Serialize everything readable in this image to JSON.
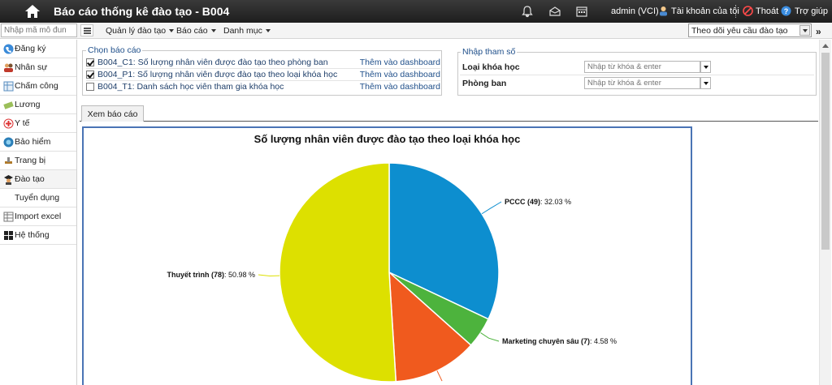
{
  "topbar": {
    "title": "Báo cáo thống kê đào tạo - B004",
    "user": "admin (VCI)",
    "account": "Tài khoản của tôi",
    "logout": "Thoát",
    "help": "Trợ giúp"
  },
  "navbar": {
    "module_placeholder": "Nhập mã mô đun",
    "menus": [
      "Quản lý đào tạo",
      "Báo cáo",
      "Danh mục"
    ],
    "track_selected": "Theo dõi yêu cầu đào tạo"
  },
  "sidebar": {
    "items": [
      {
        "label": "Đăng ký",
        "icon": "phone-icon"
      },
      {
        "label": "Nhân sự",
        "icon": "people-icon"
      },
      {
        "label": "Chấm công",
        "icon": "timesheet-icon"
      },
      {
        "label": "Lương",
        "icon": "money-icon"
      },
      {
        "label": "Y tế",
        "icon": "medical-icon"
      },
      {
        "label": "Bảo hiểm",
        "icon": "insurance-icon"
      },
      {
        "label": "Trang bị",
        "icon": "equipment-icon"
      },
      {
        "label": "Đào tạo",
        "icon": "graduate-icon"
      },
      {
        "label": "Tuyển dụng",
        "icon": ""
      },
      {
        "label": "Import excel",
        "icon": "excel-icon"
      },
      {
        "label": "Hệ thống",
        "icon": "windows-icon"
      }
    ]
  },
  "reports": {
    "legend": "Chọn báo cáo",
    "add_label": "Thêm vào dashboard",
    "items": [
      {
        "label": "B004_C1: Số lượng nhân viên được đào tạo theo phòng ban",
        "checked": true
      },
      {
        "label": "B004_P1: Số lượng nhân viên được đào tạo theo loại khóa học",
        "checked": true
      },
      {
        "label": "B004_T1: Danh sách học viên tham gia khóa học",
        "checked": false
      }
    ]
  },
  "params": {
    "legend": "Nhập tham số",
    "fields": [
      {
        "label": "Loại khóa học",
        "placeholder": "Nhập từ khóa & enter"
      },
      {
        "label": "Phòng ban",
        "placeholder": "Nhập từ khóa & enter"
      }
    ]
  },
  "tabs": {
    "view_report": "Xem báo cáo"
  },
  "chart_data": {
    "type": "pie",
    "title": "Số lượng nhân viên được đào tạo theo loại khóa học",
    "slices": [
      {
        "name": "PCCC",
        "count": 49,
        "percent": 32.03,
        "color": "#0d8ecf",
        "display": "PCCC (49)",
        "pct_text": ": 32.03 %"
      },
      {
        "name": "Marketing chuyên sâu",
        "count": 7,
        "percent": 4.58,
        "color": "#4db33d",
        "display": "Marketing chuyên sâu (7)",
        "pct_text": ": 4.58 %"
      },
      {
        "name": "",
        "count": 19,
        "percent": 12.42,
        "color": "#f05a1e",
        "display": "",
        "pct_text": ""
      },
      {
        "name": "Thuyết trình",
        "count": 78,
        "percent": 50.98,
        "color": "#dde000",
        "display": "Thuyết trình (78)",
        "pct_text": ": 50.98 %"
      }
    ]
  }
}
